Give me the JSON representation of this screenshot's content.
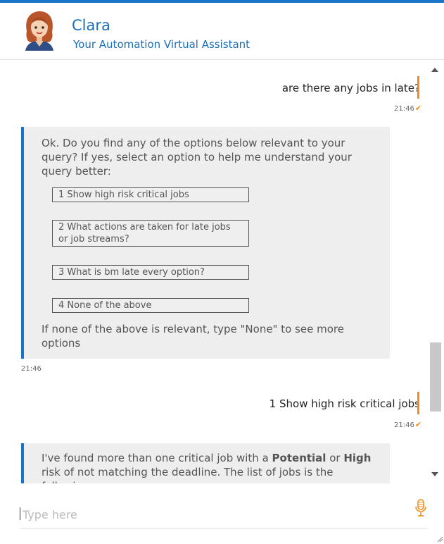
{
  "header": {
    "agent_name": "Clara",
    "agent_subtitle": "Your Automation Virtual Assistant"
  },
  "colors": {
    "brand_blue": "#1a73c8",
    "accent_orange": "#f08c1b",
    "bubble_gray": "#eeeeee"
  },
  "messages": {
    "user1": {
      "text": "are there any jobs in late?",
      "time": "21:46"
    },
    "bot1": {
      "intro": "Ok. Do you find any of the options below relevant to your query? If yes, select an option to help me understand your query better:",
      "options": [
        "1 Show high risk critical jobs",
        "2 What actions are taken for late jobs or job streams?",
        "3 What is bm late every option?",
        "4 None of the above"
      ],
      "footer": "If none of the above is relevant, type \"None\" to see more options",
      "time": "21:46"
    },
    "user2": {
      "text": "1 Show high risk critical jobs",
      "time": "21:46"
    },
    "bot2": {
      "part1": "I've found more than one critical job with a ",
      "bold1": "Potential",
      "part2": " or ",
      "bold2": "High",
      "part3": " risk of not matching the deadline. The list of jobs is the following:"
    }
  },
  "input": {
    "placeholder": "Type here"
  },
  "icons": {
    "mic": "microphone-icon",
    "read_receipt": "checkmark-icon"
  }
}
